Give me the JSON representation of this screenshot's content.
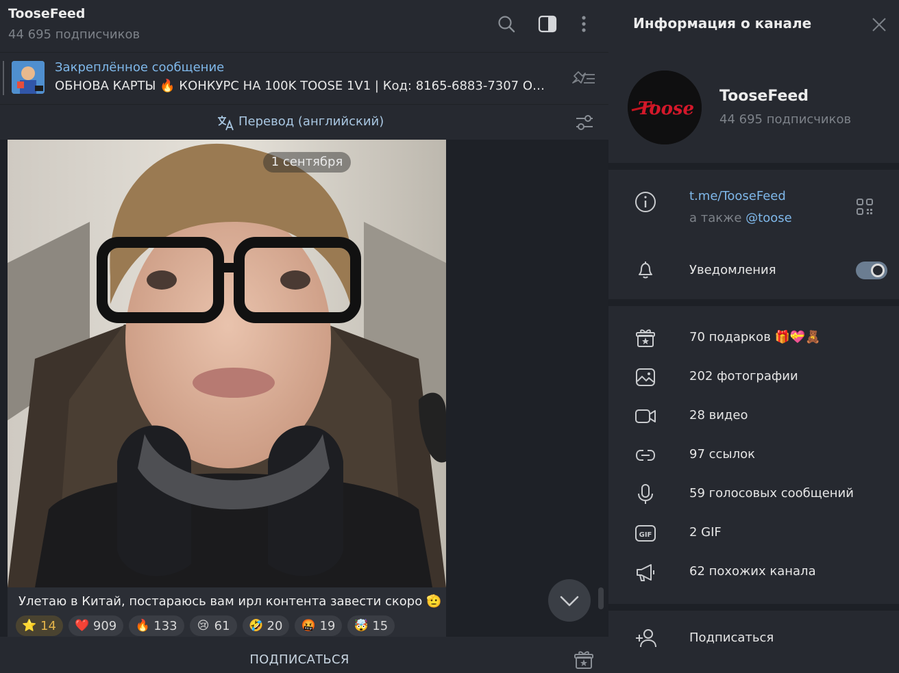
{
  "header": {
    "title": "TooseFeed",
    "subtitle": "44 695 подписчиков"
  },
  "pinned": {
    "title": "Закреплённое сообщение",
    "text": "ОБНОВА КАРТЫ 🔥 КОНКУРС НА 100K TOOSE 1V1 | Код: 8165-6883-7307  Об..."
  },
  "translate": {
    "label": "Перевод (английский)"
  },
  "post": {
    "date": "1 сентября",
    "caption": "Улетаю в Китай, постараюсь вам ирл контента завести скоро 🫡",
    "reactions": [
      {
        "emoji": "⭐",
        "count": "14",
        "paid": true
      },
      {
        "emoji": "❤️",
        "count": "909"
      },
      {
        "emoji": "🔥",
        "count": "133"
      },
      {
        "emoji": "😢",
        "count": "61"
      },
      {
        "emoji": "🤣",
        "count": "20"
      },
      {
        "emoji": "🤬",
        "count": "19"
      },
      {
        "emoji": "🤯",
        "count": "15"
      }
    ]
  },
  "bottom": {
    "subscribe_label": "ПОДПИСАТЬСЯ"
  },
  "panel": {
    "title": "Информация о канале",
    "channel_name": "TooseFeed",
    "channel_subscribers": "44 695 подписчиков",
    "avatar_text": "Toose",
    "link": "t.me/TooseFeed",
    "also_prefix": "а также ",
    "also_handle": "@toose",
    "notifications_label": "Уведомления",
    "notifications_on": true,
    "media_rows": [
      {
        "icon": "gift-icon",
        "label": "70 подарков 🎁💝🧸"
      },
      {
        "icon": "photo-icon",
        "label": "202 фотографии"
      },
      {
        "icon": "video-icon",
        "label": "28 видео"
      },
      {
        "icon": "link-icon",
        "label": "97 ссылок"
      },
      {
        "icon": "microphone-icon",
        "label": "59 голосовых сообщений"
      },
      {
        "icon": "gif-icon",
        "label": "2 GIF"
      },
      {
        "icon": "megaphone-icon",
        "label": "62 похожих канала"
      }
    ],
    "subscribe_label": "Подписаться"
  },
  "colors": {
    "accent": "#7fb8ea",
    "background": "#262930",
    "chat_background": "#1e2127"
  }
}
